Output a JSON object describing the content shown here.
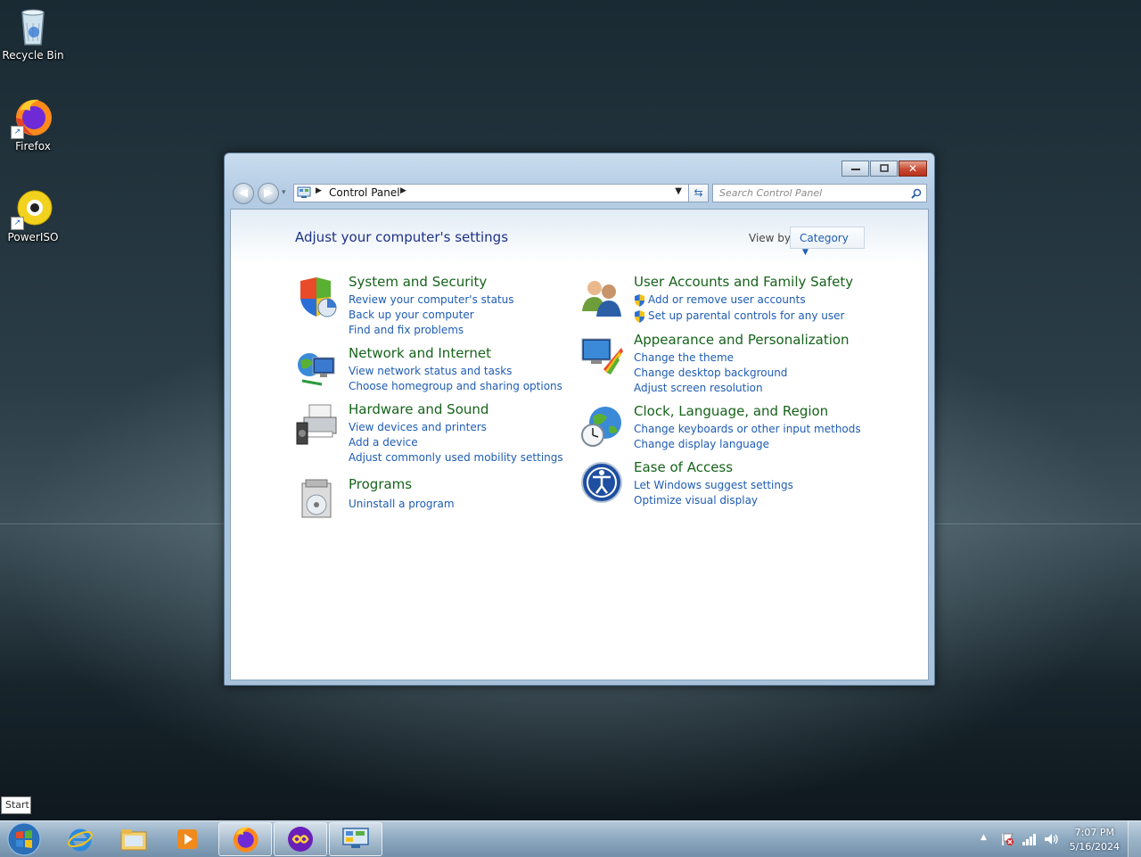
{
  "desktop": {
    "icons": [
      {
        "label": "Recycle Bin",
        "icon": "recycle-bin-icon"
      },
      {
        "label": "Firefox",
        "icon": "firefox-icon"
      },
      {
        "label": "PowerISO",
        "icon": "poweriso-icon"
      }
    ]
  },
  "window": {
    "breadcrumb": "Control Panel",
    "search_placeholder": "Search Control Panel",
    "heading": "Adjust your computer's settings",
    "view_by_label": "View by:",
    "view_by_value": "Category",
    "categories": [
      {
        "title": "System and Security",
        "icon": "system-security-icon",
        "links": [
          "Review your computer's status",
          "Back up your computer",
          "Find and fix problems"
        ]
      },
      {
        "title": "Network and Internet",
        "icon": "network-internet-icon",
        "links": [
          "View network status and tasks",
          "Choose homegroup and sharing options"
        ]
      },
      {
        "title": "Hardware and Sound",
        "icon": "hardware-sound-icon",
        "links": [
          "View devices and printers",
          "Add a device",
          "Adjust commonly used mobility settings"
        ]
      },
      {
        "title": "Programs",
        "icon": "programs-icon",
        "links": [
          "Uninstall a program"
        ]
      },
      {
        "title": "User Accounts and Family Safety",
        "icon": "user-accounts-icon",
        "links": [
          "Add or remove user accounts",
          "Set up parental controls for any user"
        ]
      },
      {
        "title": "Appearance and Personalization",
        "icon": "appearance-icon",
        "links": [
          "Change the theme",
          "Change desktop background",
          "Adjust screen resolution"
        ]
      },
      {
        "title": "Clock, Language, and Region",
        "icon": "clock-language-icon",
        "links": [
          "Change keyboards or other input methods",
          "Change display language"
        ]
      },
      {
        "title": "Ease of Access",
        "icon": "ease-of-access-icon",
        "links": [
          "Let Windows suggest settings",
          "Optimize visual display"
        ]
      }
    ]
  },
  "taskbar": {
    "start_tooltip": "Start",
    "time": "7:07 PM",
    "date": "5/16/2024"
  },
  "colors": {
    "link": "#1e5cb3",
    "category_title": "#16631a",
    "heading": "#1e3287"
  }
}
